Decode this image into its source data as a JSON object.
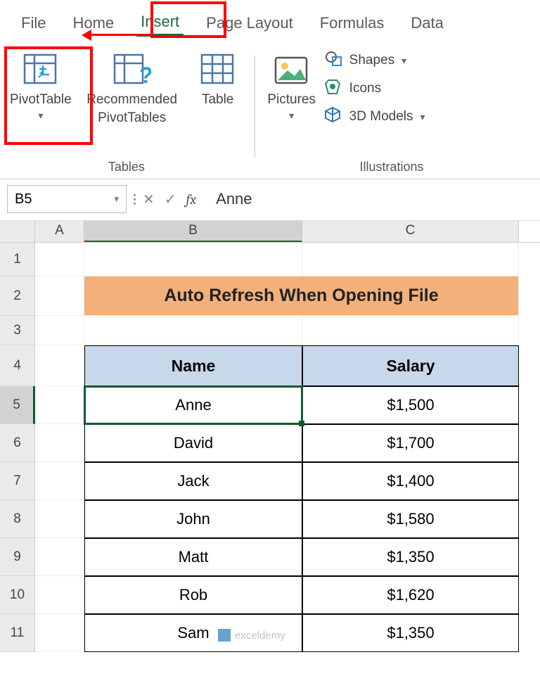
{
  "ribbon": {
    "tabs": [
      "File",
      "Home",
      "Insert",
      "Page Layout",
      "Formulas",
      "Data"
    ],
    "activeTab": "Insert",
    "btn": {
      "pivotTable": "PivotTable",
      "recommended1": "Recommended",
      "recommended2": "PivotTables",
      "table": "Table",
      "pictures": "Pictures",
      "shapes": "Shapes",
      "icons": "Icons",
      "models": "3D Models"
    },
    "group": {
      "tables": "Tables",
      "illustrations": "Illustrations"
    }
  },
  "nameBox": "B5",
  "formula": "Anne",
  "cols": {
    "a": "A",
    "b": "B",
    "c": "C"
  },
  "rows": [
    "1",
    "2",
    "3",
    "4",
    "5",
    "6",
    "7",
    "8",
    "9",
    "10",
    "11"
  ],
  "sheet": {
    "title": "Auto Refresh When Opening File",
    "header": {
      "name": "Name",
      "salary": "Salary"
    },
    "data": [
      {
        "name": "Anne",
        "salary": "$1,500"
      },
      {
        "name": "David",
        "salary": "$1,700"
      },
      {
        "name": "Jack",
        "salary": "$1,400"
      },
      {
        "name": "John",
        "salary": "$1,580"
      },
      {
        "name": "Matt",
        "salary": "$1,350"
      },
      {
        "name": "Rob",
        "salary": "$1,620"
      },
      {
        "name": "Sam",
        "salary": "$1,350"
      }
    ]
  },
  "watermark": {
    "text": "exceldemy"
  },
  "chart_data": {
    "type": "table",
    "title": "Auto Refresh When Opening File",
    "columns": [
      "Name",
      "Salary"
    ],
    "rows": [
      [
        "Anne",
        1500
      ],
      [
        "David",
        1700
      ],
      [
        "Jack",
        1400
      ],
      [
        "John",
        1580
      ],
      [
        "Matt",
        1350
      ],
      [
        "Rob",
        1620
      ],
      [
        "Sam",
        1350
      ]
    ]
  }
}
